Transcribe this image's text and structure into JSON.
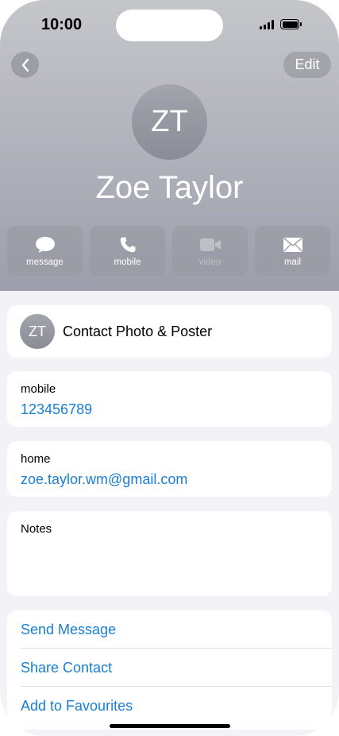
{
  "status": {
    "time": "10:00"
  },
  "nav": {
    "edit_label": "Edit"
  },
  "contact": {
    "initials": "ZT",
    "name": "Zoe Taylor"
  },
  "actions": [
    {
      "label": "message",
      "icon": "message-bubble-icon",
      "enabled": true
    },
    {
      "label": "mobile",
      "icon": "phone-icon",
      "enabled": true
    },
    {
      "label": "video",
      "icon": "video-camera-icon",
      "enabled": false
    },
    {
      "label": "mail",
      "icon": "envelope-icon",
      "enabled": true
    }
  ],
  "photo_card": {
    "initials": "ZT",
    "label": "Contact Photo & Poster"
  },
  "fields": [
    {
      "label": "mobile",
      "value": "123456789"
    },
    {
      "label": "home",
      "value": "zoe.taylor.wm@gmail.com"
    }
  ],
  "notes": {
    "label": "Notes"
  },
  "links": [
    "Send Message",
    "Share Contact",
    "Add to Favourites"
  ],
  "colors": {
    "link": "#1a7ed2",
    "background": "#f2f2f7"
  }
}
